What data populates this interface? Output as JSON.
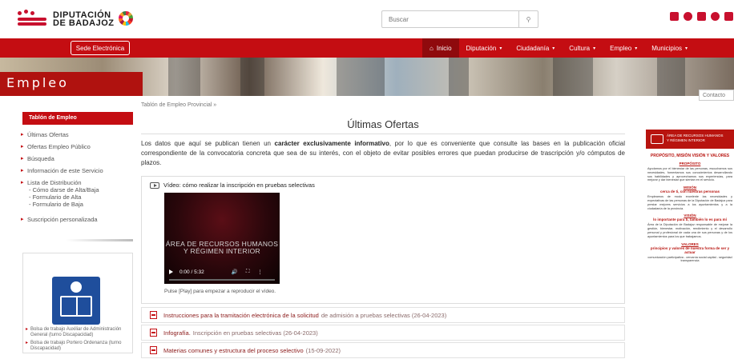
{
  "header": {
    "logo_line1": "DIPUTACIÓN",
    "logo_line2": "DE BADAJOZ",
    "search_placeholder": "Buscar"
  },
  "nav": {
    "sede_label": "Sede Electrónica",
    "items": [
      {
        "label": "Inicio",
        "icon": "home-icon",
        "active": true
      },
      {
        "label": "Diputación",
        "caret": true
      },
      {
        "label": "Ciudadanía",
        "caret": true
      },
      {
        "label": "Cultura",
        "caret": true
      },
      {
        "label": "Empleo",
        "caret": true
      },
      {
        "label": "Municipios",
        "caret": true
      }
    ]
  },
  "banner": {
    "section_title": "Empleo",
    "contact_label": "Contacto"
  },
  "sidebar": {
    "heading": "Tablón de Empleo",
    "items": [
      "Últimas Ofertas",
      "Ofertas Empleo Público",
      "Búsqueda",
      "Información de este Servicio"
    ],
    "distribution": {
      "label": "Lista de Distribución",
      "subs": [
        "- Cómo darse de Alta/Baja",
        "- Formulario de Alta",
        "- Formulario de Baja"
      ]
    },
    "subscription": "Suscripción personalizada",
    "box_links": [
      "Bolsa de trabajo Auxiliar de Administración General (turno Discapacidad)",
      "Bolsa de trabajo Portero Ordenanza (turno Discapacidad)"
    ]
  },
  "main": {
    "breadcrumb": "Tablón de Empleo Provincial »",
    "title": "Últimas Ofertas",
    "intro_prefix": "Los datos que aquí se publican tienen un ",
    "intro_bold": "carácter exclusivamente informativo",
    "intro_suffix": ", por lo que es conveniente que consulte las bases en la publicación oficial correspondiente de la convocatoria concreta que sea de su interés, con el objeto de evitar posibles errores que puedan producirse de trascripción y/o cómputos de plazos.",
    "video": {
      "heading": "Vídeo: cómo realizar la inscripción en pruebas selectivas",
      "player_line1": "ÁREA DE RECURSOS HUMANOS",
      "player_line2": "Y RÉGIMEN INTERIOR",
      "time": "0:00 / 5:32",
      "progress": 0,
      "caption": "Pulse [Play] para empezar a reproducir el vídeo."
    },
    "documents": [
      {
        "link": "Instrucciones para la tramitación electrónica de la solicitud",
        "rest": " de admisión a pruebas selectivas (26-04-2023)"
      },
      {
        "link": "Infografía.",
        "rest": " Inscripción en pruebas selectivas (26-04-2023)"
      },
      {
        "link": "Materias comunes y estructura del proceso selectivo",
        "rest": " (15-09-2022)"
      }
    ]
  },
  "right_panel": {
    "header_line1": "ÁREA DE RECURSOS HUMANOS",
    "header_line2": "Y RÉGIMEN INTERIOR",
    "title": "PROPÓSITO, MISIÓN VISIÓN Y VALORES",
    "proposito": "PROPÓSITO",
    "proposito_text": "Ayudamos por el bienestar de las personas, escuchamos sus necesidades, fomentamos sus conocimientos desarrollando sus habilidades y aprovechamos sus experiencias, para mejorar y dar bienestar que sientan en el servicio.",
    "mision": "MISIÓN",
    "mision_sub": "cerca de ti, con nuestras personas",
    "mision_text": "Empleamos de modo excelente las necesidades y expectativas de las personas de la Diputación de Badajoz para prestar mejores servicios a los ayuntamientos y a la ciudadanía de la provincia.",
    "vision": "VISIÓN",
    "vision_sub": "lo importante para ti, también lo es para mí",
    "vision_text": "Área de la Diputación de Badajoz responsable de mejorar la gestión, bienestar, motivación, rendimiento y el desarrollo personal y profesional de cada una de sus personas y de los ayuntamientos para los que trabajamos.",
    "valores": "VALORES",
    "valores_sub": "principios y valores de nuestra forma de ser y actuar",
    "valores_text": "comunicación participativa - cercanía social capital - seguridad transparencia"
  },
  "colors": {
    "brand_red": "#c40d12",
    "active_red": "#8f0a0d"
  }
}
